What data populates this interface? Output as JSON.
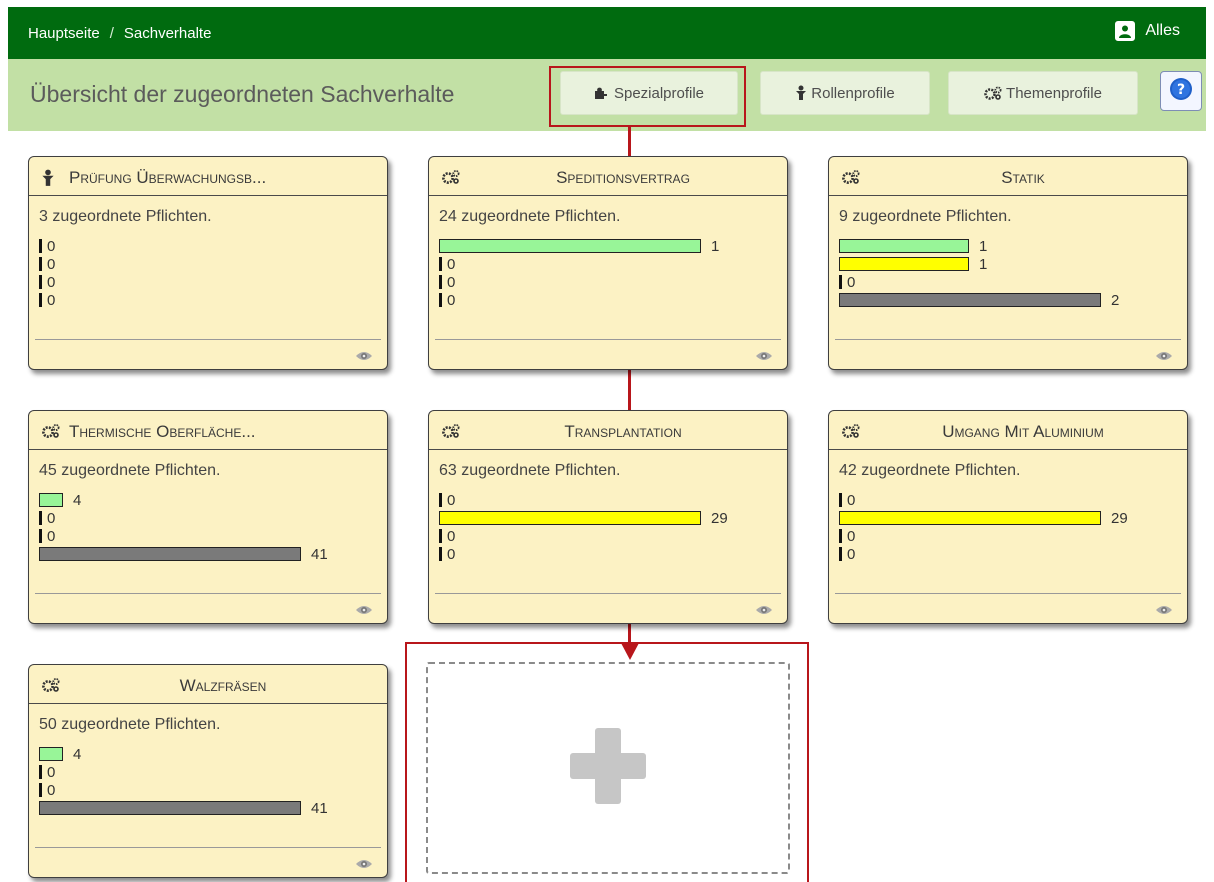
{
  "nav": {
    "breadcrumb_home": "Hauptseite",
    "breadcrumb_sep": "/",
    "breadcrumb_current": "Sachverhalte",
    "user_label": "Alles"
  },
  "subheader": {
    "title": "Übersicht der zugeordneten Sachverhalte",
    "buttons": [
      {
        "label": "Spezialprofile",
        "icon": "puzzle-icon"
      },
      {
        "label": "Rollenprofile",
        "icon": "person-icon"
      },
      {
        "label": "Themenprofile",
        "icon": "gears-icon"
      }
    ],
    "help_icon": "question-icon"
  },
  "colors": {
    "nav_bg": "#006b0f",
    "subheader_bg": "#c2e0a5",
    "card_bg": "#fcf2c4",
    "bar_green": "#98f598",
    "bar_yellow": "#ffff00",
    "bar_gray": "#7a7a7a",
    "annotation_red": "#b8161b"
  },
  "cards": [
    {
      "title": "Prüfung Überwachungsb...",
      "icon": "person-icon",
      "summary": "3 zugeordnete Pflichten.",
      "bars": [
        {
          "color": "none",
          "value": "0"
        },
        {
          "color": "none",
          "value": "0"
        },
        {
          "color": "none",
          "value": "0"
        },
        {
          "color": "none",
          "value": "0"
        }
      ]
    },
    {
      "title": "Speditionsvertrag",
      "icon": "gears-icon",
      "summary": "24 zugeordnete Pflichten.",
      "bars": [
        {
          "color": "green",
          "value": "1"
        },
        {
          "color": "none",
          "value": "0"
        },
        {
          "color": "none",
          "value": "0"
        },
        {
          "color": "none",
          "value": "0"
        }
      ]
    },
    {
      "title": "Statik",
      "icon": "gears-icon",
      "summary": "9 zugeordnete Pflichten.",
      "bars": [
        {
          "color": "green",
          "value": "1"
        },
        {
          "color": "yellow",
          "value": "1"
        },
        {
          "color": "none",
          "value": "0"
        },
        {
          "color": "gray",
          "value": "2"
        }
      ]
    },
    {
      "title": "Thermische Oberfläche...",
      "icon": "gears-icon",
      "summary": "45 zugeordnete Pflichten.",
      "bars": [
        {
          "color": "green",
          "value": "4"
        },
        {
          "color": "none",
          "value": "0"
        },
        {
          "color": "none",
          "value": "0"
        },
        {
          "color": "gray",
          "value": "41"
        }
      ]
    },
    {
      "title": "Transplantation",
      "icon": "gears-icon",
      "summary": "63 zugeordnete Pflichten.",
      "bars": [
        {
          "color": "none",
          "value": "0"
        },
        {
          "color": "yellow",
          "value": "29"
        },
        {
          "color": "none",
          "value": "0"
        },
        {
          "color": "none",
          "value": "0"
        }
      ]
    },
    {
      "title": "Umgang Mit Aluminium",
      "icon": "gears-icon",
      "summary": "42 zugeordnete Pflichten.",
      "bars": [
        {
          "color": "none",
          "value": "0"
        },
        {
          "color": "yellow",
          "value": "29"
        },
        {
          "color": "none",
          "value": "0"
        },
        {
          "color": "none",
          "value": "0"
        }
      ]
    },
    {
      "title": "Walzfräsen",
      "icon": "gears-icon",
      "summary": "50 zugeordnete Pflichten.",
      "bars": [
        {
          "color": "green",
          "value": "4"
        },
        {
          "color": "none",
          "value": "0"
        },
        {
          "color": "none",
          "value": "0"
        },
        {
          "color": "gray",
          "value": "41"
        }
      ]
    }
  ],
  "add_tile": {
    "icon": "plus-icon"
  }
}
